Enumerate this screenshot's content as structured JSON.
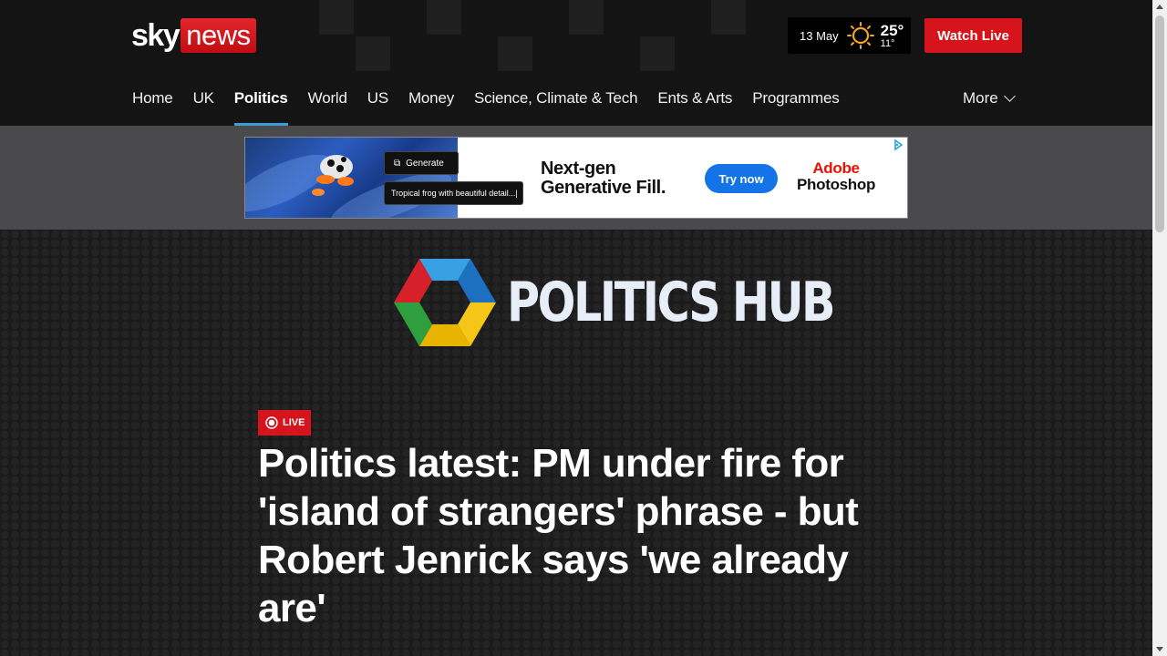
{
  "header": {
    "logo_sky": "sky",
    "logo_news": "news",
    "weather": {
      "date": "13 May",
      "high": "25°",
      "low": "11°",
      "icon": "sun-icon"
    },
    "watch_live": "Watch Live"
  },
  "nav": {
    "items": [
      {
        "label": "Home"
      },
      {
        "label": "UK"
      },
      {
        "label": "Politics",
        "active": true
      },
      {
        "label": "World"
      },
      {
        "label": "US"
      },
      {
        "label": "Money"
      },
      {
        "label": "Science, Climate & Tech"
      },
      {
        "label": "Ents & Arts"
      },
      {
        "label": "Programmes"
      }
    ],
    "more": "More"
  },
  "ad": {
    "generate_label": "Generate",
    "prompt_text": "Tropical frog with beautiful detail...|",
    "headline_1": "Next-gen",
    "headline_2": "Generative Fill.",
    "cta": "Try now",
    "brand_1": "Adobe",
    "brand_2": "Photoshop"
  },
  "hub": {
    "title": "POLITICS HUB"
  },
  "article": {
    "badge": "LIVE",
    "headline": "Politics latest: PM under fire for 'island of strangers' phrase - but Robert Jenrick says 'we already are'"
  },
  "colors": {
    "brand_red": "#d5141b",
    "nav_active_underline": "#3b9cd7",
    "header_bg": "#141414",
    "ad_cta": "#1473e6"
  }
}
